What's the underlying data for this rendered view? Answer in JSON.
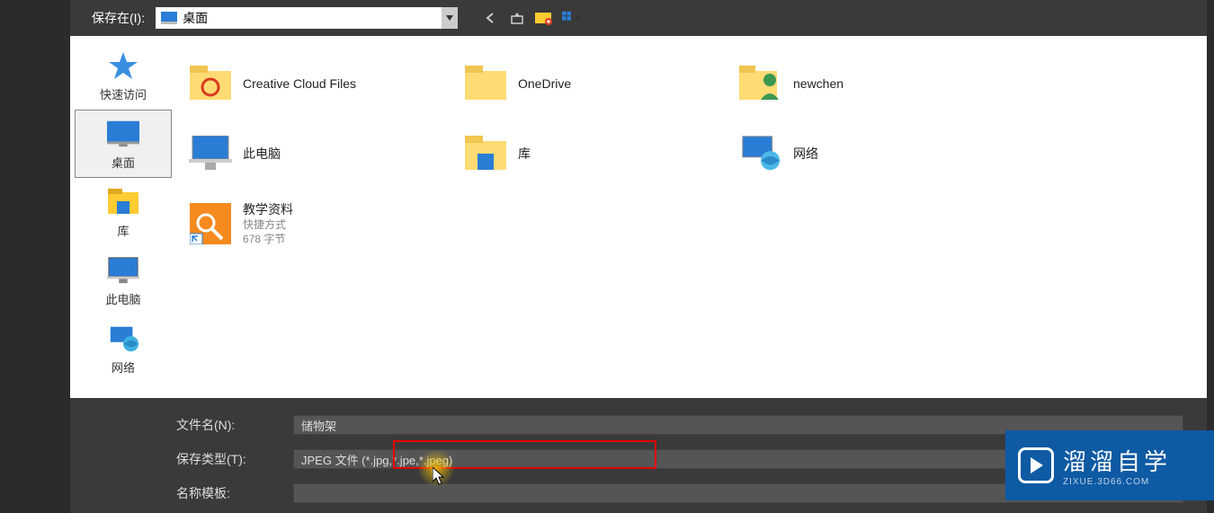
{
  "top": {
    "save_in_label": "保存在(I):",
    "path_value": "桌面"
  },
  "sidebar": {
    "items": [
      {
        "label": "快速访问"
      },
      {
        "label": "桌面"
      },
      {
        "label": "库"
      },
      {
        "label": "此电脑"
      },
      {
        "label": "网络"
      }
    ]
  },
  "grid": {
    "row1": [
      {
        "label": "Creative Cloud Files"
      },
      {
        "label": "OneDrive"
      },
      {
        "label": "newchen"
      }
    ],
    "row2": [
      {
        "label": "此电脑"
      },
      {
        "label": "库"
      },
      {
        "label": "网络"
      }
    ],
    "row3": {
      "label": "教学资料",
      "sub1": "快捷方式",
      "sub2": "678 字节"
    }
  },
  "bottom": {
    "filename_label": "文件名(N):",
    "filename_value": "储物架",
    "filetype_label": "保存类型(T):",
    "filetype_value": "JPEG 文件 (*.jpg,*.jpe,*.jpeg)",
    "template_label": "名称模板:"
  },
  "watermark": {
    "title": "溜溜自学",
    "sub": "ZIXUE.3D66.COM"
  }
}
